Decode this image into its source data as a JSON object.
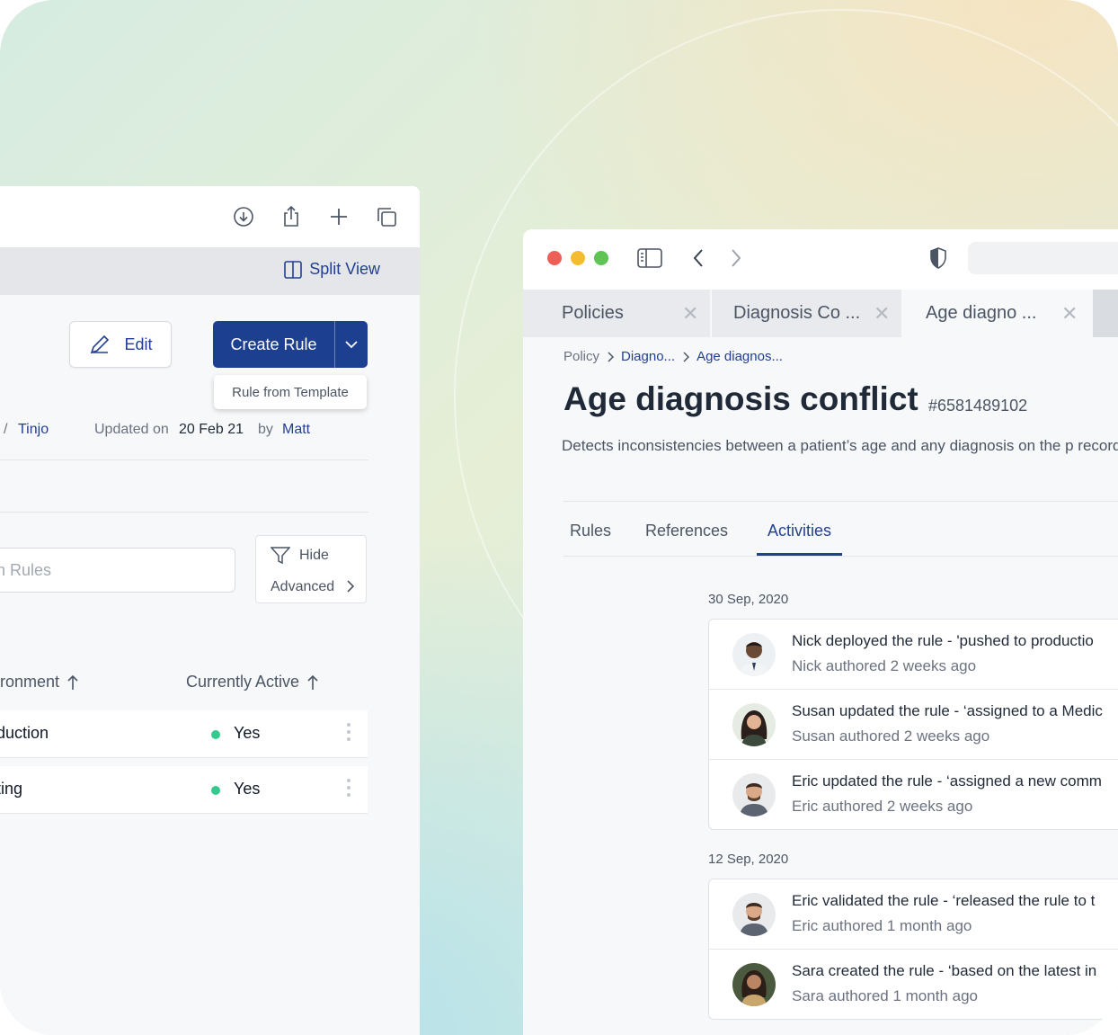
{
  "left_window": {
    "toolbar_icons": [
      "download-icon",
      "share-icon",
      "plus-icon",
      "copy-icon"
    ],
    "split_view_label": "Split View",
    "edit_label": "Edit",
    "create_rule_label": "Create Rule",
    "rule_from_template_label": "Rule from Template",
    "meta": {
      "author": "Tinjo",
      "updated_on_label": "Updated on",
      "updated_date": "20 Feb 21",
      "by_label": "by",
      "updated_by": "Matt"
    },
    "search_placeholder": "rch Rules",
    "filter": {
      "line1": "Hide",
      "line2": "Advanced"
    },
    "columns": {
      "environment": "ironment",
      "currently_active": "Currently Active"
    },
    "rows": [
      {
        "name": "duction",
        "active": "Yes"
      },
      {
        "name": "ting",
        "active": "Yes"
      }
    ],
    "colors": {
      "accent": "#1d3f8f",
      "active_dot": "#34c98e"
    }
  },
  "right_window": {
    "tabs": [
      {
        "label": "Policies"
      },
      {
        "label": "Diagnosis Co ..."
      },
      {
        "label": "Age diagno ..."
      }
    ],
    "breadcrumb": {
      "root": "Policy",
      "middle": "Diagno...",
      "current": "Age diagnos..."
    },
    "title": "Age diagnosis conflict",
    "policy_id": "#6581489102",
    "description": "Detects inconsistencies between a patient’s age and any diagnosis on the p record.",
    "subtabs": {
      "rules": "Rules",
      "references": "References",
      "activities": "Activities"
    },
    "activity_groups": [
      {
        "date": "30 Sep, 2020",
        "items": [
          {
            "title": "Nick deployed the rule - 'pushed to productio",
            "subtitle": "Nick authored 2 weeks ago"
          },
          {
            "title": "Susan updated the rule - ‘assigned to a Medic",
            "subtitle": "Susan authored 2 weeks ago"
          },
          {
            "title": "Eric updated the rule - ‘assigned a new comm",
            "subtitle": "Eric authored 2 weeks ago"
          }
        ]
      },
      {
        "date": "12 Sep, 2020",
        "items": [
          {
            "title": "Eric validated the rule - ‘released the rule to t",
            "subtitle": "Eric authored 1 month ago"
          },
          {
            "title": "Sara created the rule - ‘based on the latest in",
            "subtitle": "Sara authored 1 month ago"
          }
        ]
      }
    ],
    "colors": {
      "close": "#ee5f57",
      "minimize": "#f4bc2f",
      "maximize": "#5fc454",
      "accent": "#22408f"
    }
  }
}
